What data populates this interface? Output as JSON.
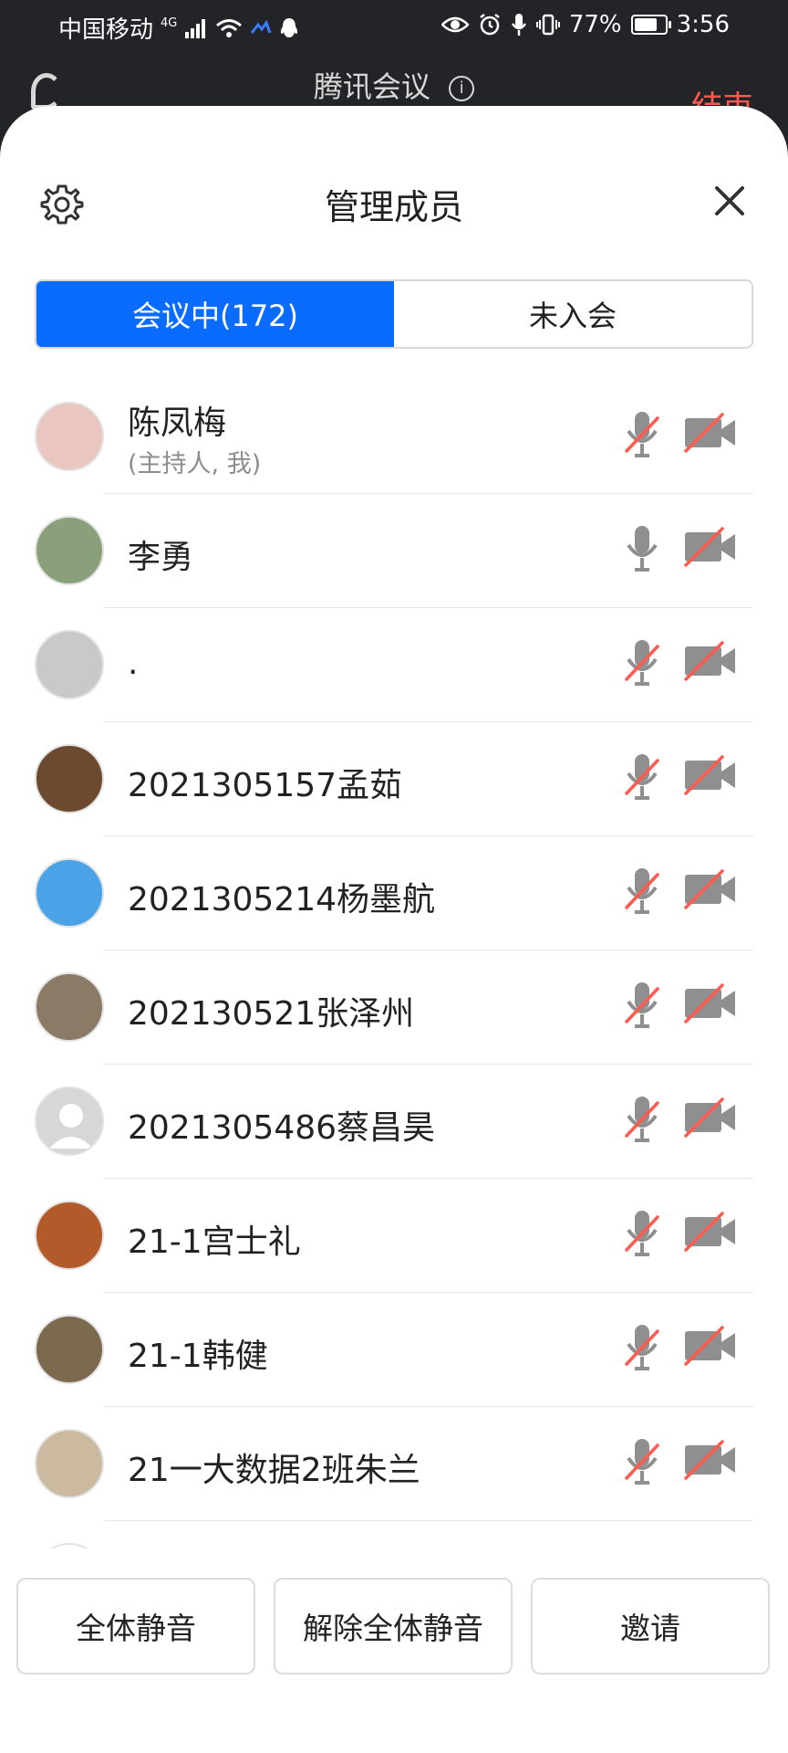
{
  "status_bar": {
    "carrier": "中国移动",
    "network": "4G",
    "battery": "77%",
    "battery_level": 0.77,
    "time": "3:56"
  },
  "meeting": {
    "title": "腾讯会议",
    "end_label": "结束"
  },
  "sheet": {
    "title": "管理成员",
    "tabs": [
      {
        "label": "会议中(172)",
        "active": true
      },
      {
        "label": "未入会",
        "active": false
      }
    ]
  },
  "members": [
    {
      "name": "陈凤梅",
      "sub": "(主持人, 我)",
      "mic": "muted",
      "camera": "off",
      "avatar_color": "#e9c7c0"
    },
    {
      "name": "李勇",
      "sub": "",
      "mic": "on",
      "camera": "off",
      "avatar_color": "#8aa07a"
    },
    {
      "name": ".",
      "sub": "",
      "mic": "muted",
      "camera": "off",
      "avatar_color": "#c9c9c9"
    },
    {
      "name": "2021305157孟茹",
      "sub": "",
      "mic": "muted",
      "camera": "off",
      "avatar_color": "#6b4a2f"
    },
    {
      "name": "2021305214杨墨航",
      "sub": "",
      "mic": "muted",
      "camera": "off",
      "avatar_color": "#4aa3e6"
    },
    {
      "name": "202130521张泽州",
      "sub": "",
      "mic": "muted",
      "camera": "off",
      "avatar_color": "#8a7a66"
    },
    {
      "name": "2021305486蔡昌昊",
      "sub": "",
      "mic": "muted",
      "camera": "off",
      "avatar_color": "#d7d7d7"
    },
    {
      "name": "21-1宫士礼",
      "sub": "",
      "mic": "muted",
      "camera": "off",
      "avatar_color": "#b25a2a"
    },
    {
      "name": "21-1韩健",
      "sub": "",
      "mic": "muted",
      "camera": "off",
      "avatar_color": "#7c6a4f"
    },
    {
      "name": "21一大数据2班朱兰",
      "sub": "",
      "mic": "muted",
      "camera": "off",
      "avatar_color": "#cbb9a0"
    },
    {
      "name": "",
      "sub": "",
      "mic": "muted",
      "camera": "off",
      "avatar_color": "#ffffff"
    }
  ],
  "actions": {
    "mute_all": "全体静音",
    "unmute_all": "解除全体静音",
    "invite": "邀请"
  },
  "colors": {
    "accent": "#0a6cff",
    "danger": "#ff5a4f",
    "icon_gray": "#8f8f8f"
  }
}
